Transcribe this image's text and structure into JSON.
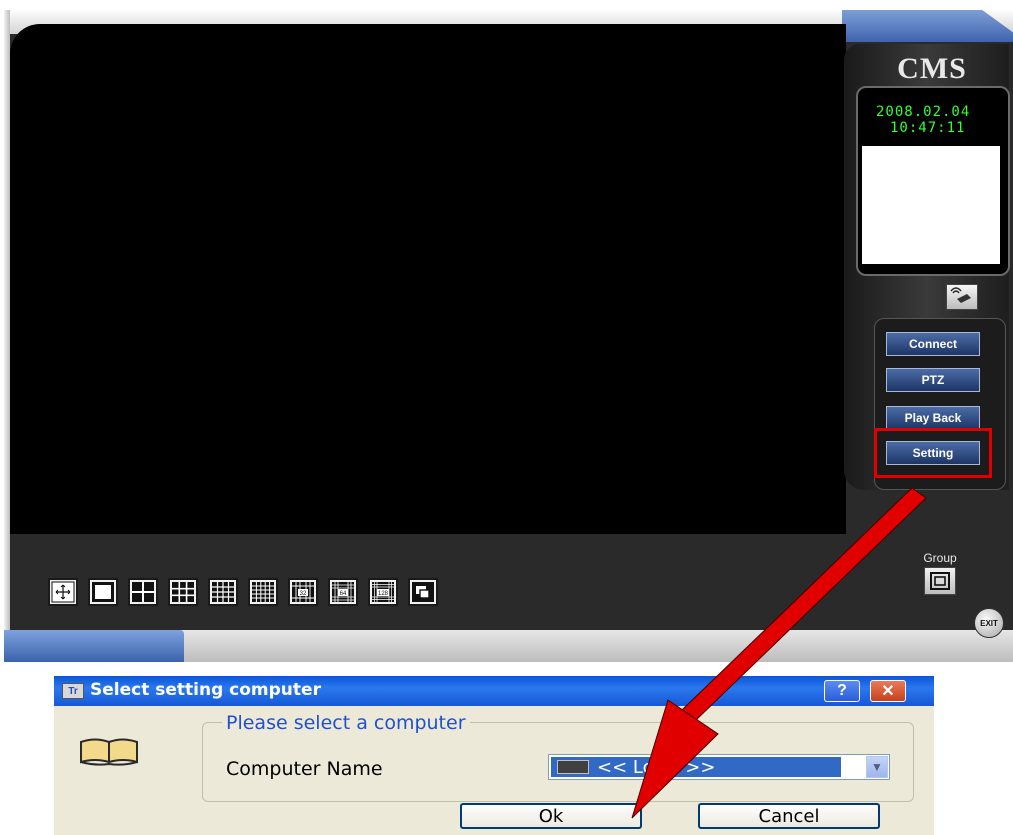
{
  "cms": {
    "logo": "CMS",
    "clock_date": "2008.02.04",
    "clock_time": "10:47:11",
    "buttons": {
      "connect": "Connect",
      "ptz": "PTZ",
      "playback": "Play Back",
      "setting": "Setting"
    },
    "group_label": "Group",
    "exit_label": "EXIT",
    "layout_buttons": [
      "1",
      "4",
      "9",
      "16",
      "25",
      "32",
      "64",
      "128",
      "PiP"
    ],
    "layout_labels": {
      "l32": "32",
      "l64": "64",
      "l128": "128"
    }
  },
  "dialog": {
    "title": "Select setting computer",
    "title_icon": "Tr",
    "help_label": "?",
    "close_label": "✕",
    "group_legend": "Please select a computer",
    "computer_name_label": "Computer Name",
    "computer_name_value": "<< Local >>",
    "ok_label": "Ok",
    "cancel_label": "Cancel"
  },
  "colors": {
    "highlight": "#e00000",
    "clock_text": "#33ff33",
    "xp_title": "#0a56d8"
  }
}
